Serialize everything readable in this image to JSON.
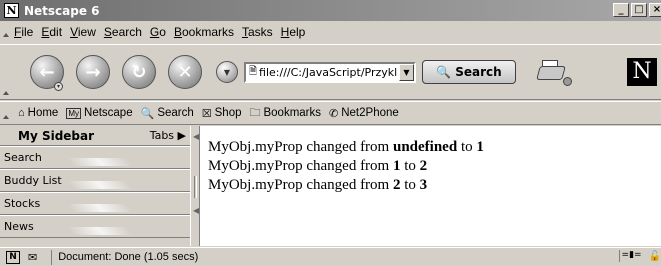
{
  "window": {
    "title": "Netscape 6",
    "app_icon": "N",
    "buttons": [
      "_",
      "□",
      "×"
    ]
  },
  "menubar": {
    "items": [
      {
        "u": "F",
        "rest": "ile"
      },
      {
        "u": "E",
        "rest": "dit"
      },
      {
        "u": "V",
        "rest": "iew"
      },
      {
        "u": "S",
        "rest": "earch"
      },
      {
        "u": "G",
        "rest": "o"
      },
      {
        "u": "B",
        "rest": "ookmarks"
      },
      {
        "u": "T",
        "rest": "asks"
      },
      {
        "u": "H",
        "rest": "elp"
      }
    ]
  },
  "navbar": {
    "back_icon": "back-icon",
    "forward_icon": "forward-icon",
    "reload_icon": "reload-icon",
    "stop_icon": "stop-icon",
    "url": "file:///C:/JavaScript/Przykl",
    "search_label": "Search",
    "throbber": "N"
  },
  "personal": {
    "home": "Home",
    "my_netscape_box": "My",
    "my_netscape": "Netscape",
    "search": "Search",
    "shop": "Shop",
    "bookmarks": "Bookmarks",
    "net2phone": "Net2Phone"
  },
  "sidebar": {
    "title": "My Sidebar",
    "tabs": "Tabs ▶",
    "panels": [
      "Search",
      "Buddy List",
      "Stocks",
      "News"
    ]
  },
  "content": {
    "lines": [
      {
        "prefix": "MyObj.myProp changed from ",
        "from": "undefined",
        "mid": " to ",
        "to": "1"
      },
      {
        "prefix": "MyObj.myProp changed from ",
        "from": "1",
        "mid": " to ",
        "to": "2"
      },
      {
        "prefix": "MyObj.myProp changed from ",
        "from": "2",
        "mid": " to ",
        "to": "3"
      }
    ]
  },
  "statusbar": {
    "text": "Document: Done (1.05 secs)"
  }
}
